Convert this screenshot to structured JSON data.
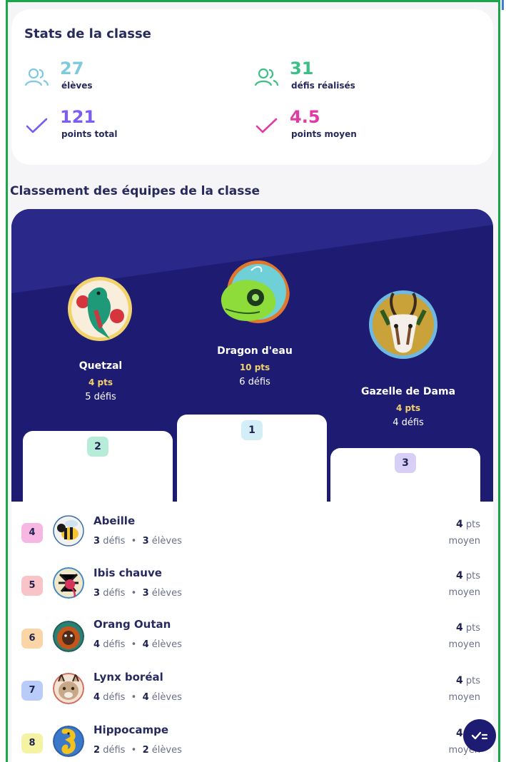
{
  "stats": {
    "title": "Stats de la classe",
    "items": [
      {
        "value": "27",
        "label": "élèves",
        "icon": "users-icon",
        "color": "#7cc9e0"
      },
      {
        "value": "31",
        "label": "défis réalisés",
        "icon": "users-icon",
        "color": "#3bbf87"
      },
      {
        "value": "121",
        "label": "points total",
        "icon": "check-icon",
        "color": "#7b5cf5"
      },
      {
        "value": "4.5",
        "label": "points moyen",
        "icon": "check-icon",
        "color": "#e23aa5"
      }
    ]
  },
  "ranking": {
    "title": "Classement des équipes de la classe",
    "podium": [
      {
        "rank": "2",
        "name": "Quetzal",
        "points": "4 pts",
        "defis": "5 défis",
        "chip_color": "#b7ecd9"
      },
      {
        "rank": "1",
        "name": "Dragon d'eau",
        "points": "10 pts",
        "defis": "6 défis",
        "chip_color": "#d3eef7"
      },
      {
        "rank": "3",
        "name": "Gazelle de Dama",
        "points": "4 pts",
        "defis": "4 défis",
        "chip_color": "#d8cff7"
      }
    ],
    "list": [
      {
        "rank": "4",
        "name": "Abeille",
        "defis": "3",
        "defis_label": "défis",
        "eleves": "3",
        "eleves_label": "élèves",
        "score": "4",
        "score_unit": "pts",
        "score_label": "moyen",
        "chip_color": "#f7b7e3",
        "avatar_color": "#f5c431"
      },
      {
        "rank": "5",
        "name": "Ibis chauve",
        "defis": "3",
        "defis_label": "défis",
        "eleves": "3",
        "eleves_label": "élèves",
        "score": "4",
        "score_unit": "pts",
        "score_label": "moyen",
        "chip_color": "#f9c4c8",
        "avatar_color": "#3f88c5"
      },
      {
        "rank": "6",
        "name": "Orang Outan",
        "defis": "4",
        "defis_label": "défis",
        "eleves": "4",
        "eleves_label": "élèves",
        "score": "4",
        "score_unit": "pts",
        "score_label": "moyen",
        "chip_color": "#fbd5a6",
        "avatar_color": "#d86a1c"
      },
      {
        "rank": "7",
        "name": "Lynx boréal",
        "defis": "4",
        "defis_label": "défis",
        "eleves": "4",
        "eleves_label": "élèves",
        "score": "4",
        "score_unit": "pts",
        "score_label": "moyen",
        "chip_color": "#b8cbf9",
        "avatar_color": "#c8a889"
      },
      {
        "rank": "8",
        "name": "Hippocampe",
        "defis": "2",
        "defis_label": "défis",
        "eleves": "2",
        "eleves_label": "élèves",
        "score": "4",
        "score_unit": "pts",
        "score_label": "moyen",
        "chip_color": "#f4f3a3",
        "avatar_color": "#3a78c9"
      }
    ]
  },
  "fab": {
    "icon": "checklist-icon"
  }
}
